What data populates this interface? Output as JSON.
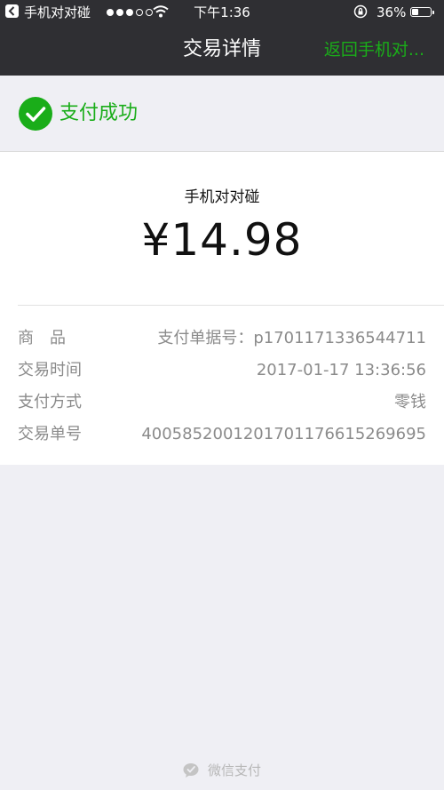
{
  "status_bar": {
    "back_app": "手机对对碰",
    "time": "下午1:36",
    "battery": "36%",
    "battery_level": 0.36
  },
  "nav": {
    "title": "交易详情",
    "back_link": "返回手机对..."
  },
  "status": {
    "text": "支付成功",
    "color": "#1aad19"
  },
  "payment": {
    "merchant": "手机对对碰",
    "amount": "¥14.98"
  },
  "details": [
    {
      "label": "商　品",
      "value": "支付单据号：p1701171336544711"
    },
    {
      "label": "交易时间",
      "value": "2017-01-17 13:36:56"
    },
    {
      "label": "支付方式",
      "value": "零钱"
    },
    {
      "label": "交易单号",
      "value": "4005852001201701176615269695"
    }
  ],
  "footer": {
    "text": "微信支付"
  },
  "icons": [
    "back-arrow-icon",
    "wifi-icon",
    "rotation-lock-icon",
    "battery-icon",
    "checkmark-icon",
    "wechat-pay-icon"
  ]
}
